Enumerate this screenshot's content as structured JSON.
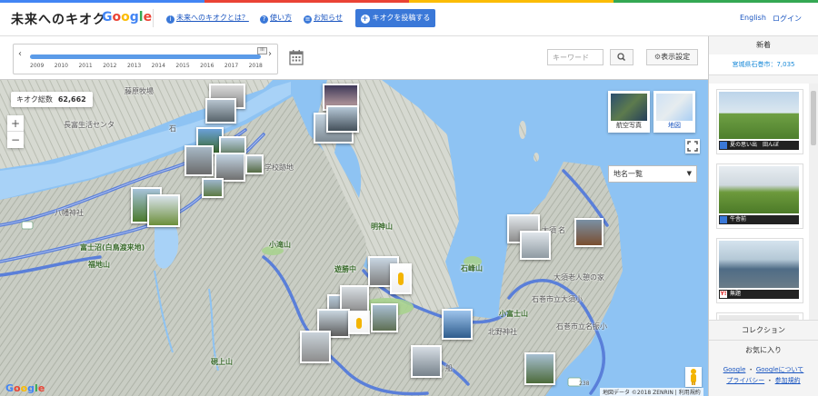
{
  "header": {
    "site_title": "未来へのキオク",
    "google_logo": "Google",
    "nav": [
      {
        "label": "未来へのキオクとは？",
        "icon": "info-icon"
      },
      {
        "label": "使い方",
        "icon": "help-icon"
      },
      {
        "label": "お知らせ",
        "icon": "news-icon"
      }
    ],
    "post_button": "キオクを投稿する",
    "english": "English",
    "login": "ログイン",
    "brand_colors": [
      "#4285f4",
      "#ea4335",
      "#fbbc05",
      "#34a853"
    ]
  },
  "toolbar": {
    "years": [
      "2009",
      "2010",
      "2011",
      "2012",
      "2013",
      "2014",
      "2015",
      "2016",
      "2017",
      "2018"
    ],
    "timeline_handle": "III",
    "keyword_placeholder": "キーワード",
    "display_settings": "表示設定"
  },
  "map": {
    "total_label": "キオク総数",
    "total_count": "62,662",
    "map_types": [
      {
        "label": "航空写真"
      },
      {
        "label": "地図"
      }
    ],
    "place_select": "地名一覧",
    "labels": [
      "藤原牧場",
      "長富生活センタ",
      "石",
      "学校跡地",
      "八幡神社",
      "富士沼(白鳥渡来地)",
      "福地山",
      "小滝山",
      "明神山",
      "遊勝中",
      "石峰山",
      "大須老人憩の家",
      "石巻市立大須小",
      "小富士山",
      "北野神社",
      "石巻市立名振小",
      "硯上山",
      "船",
      "名",
      "大須"
    ],
    "route_shields": [
      "238"
    ],
    "copyright": "地図データ ©2018 ZENRIN | 利用規約",
    "google_logo": "Google"
  },
  "sidebar": {
    "heading": "新着",
    "location": "宮城県石巻市：7,035",
    "cards": [
      {
        "caption": "夏の思い出　田んぼ",
        "badge": "user"
      },
      {
        "caption": "牛舎前",
        "badge": "user"
      },
      {
        "caption": "無題",
        "badge": "yahoo"
      }
    ],
    "collection": "コレクション",
    "favorites": "お気に入り",
    "footer": {
      "google": "Google",
      "about_google": "Googleについて",
      "privacy": "プライバシー",
      "terms": "参加規約"
    }
  }
}
